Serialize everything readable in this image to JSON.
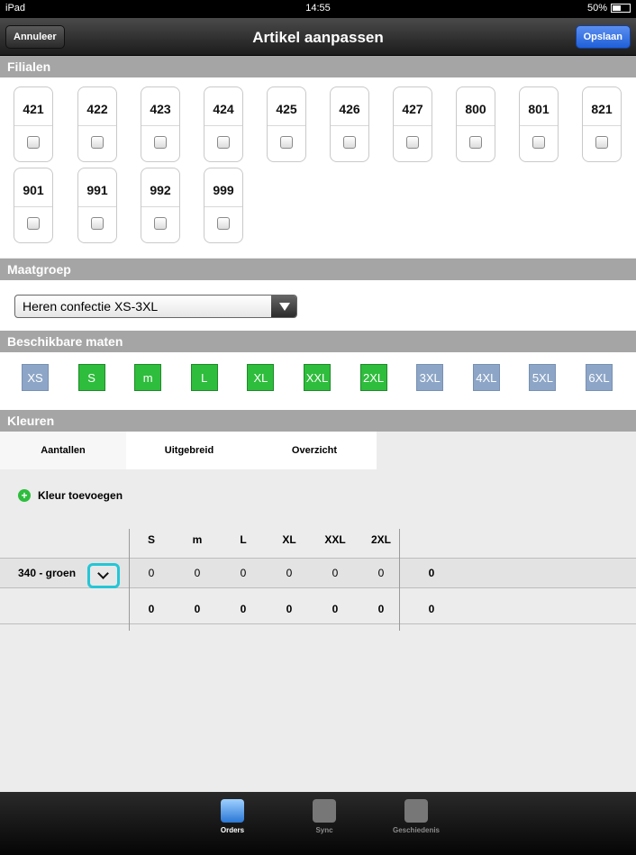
{
  "status_bar": {
    "device": "iPad",
    "time": "14:55",
    "battery": "50%"
  },
  "nav": {
    "title": "Artikel aanpassen",
    "cancel_label": "Annuleer",
    "save_label": "Opslaan"
  },
  "sections": {
    "filialen": "Filialen",
    "maatgroep": "Maatgroep",
    "maten": "Beschikbare maten",
    "kleuren": "Kleuren"
  },
  "filialen": [
    "421",
    "422",
    "423",
    "424",
    "425",
    "426",
    "427",
    "800",
    "801",
    "821",
    "901",
    "991",
    "992",
    "999"
  ],
  "maatgroep": {
    "selected": "Heren confectie XS-3XL"
  },
  "sizes": [
    {
      "label": "XS",
      "active": false
    },
    {
      "label": "S",
      "active": true
    },
    {
      "label": "m",
      "active": true
    },
    {
      "label": "L",
      "active": true
    },
    {
      "label": "XL",
      "active": true
    },
    {
      "label": "XXL",
      "active": true
    },
    {
      "label": "2XL",
      "active": true
    },
    {
      "label": "3XL",
      "active": false
    },
    {
      "label": "4XL",
      "active": false
    },
    {
      "label": "5XL",
      "active": false
    },
    {
      "label": "6XL",
      "active": false
    }
  ],
  "tabs": [
    "Aantallen",
    "Uitgebreid",
    "Overzicht"
  ],
  "add_color_label": "Kleur toevoegen",
  "grid": {
    "headers": [
      "S",
      "m",
      "L",
      "XL",
      "XXL",
      "2XL"
    ],
    "rows": [
      {
        "label": "340 - groen",
        "values": [
          "0",
          "0",
          "0",
          "0",
          "0",
          "0"
        ],
        "total": "0"
      }
    ],
    "totals": {
      "values": [
        "0",
        "0",
        "0",
        "0",
        "0",
        "0"
      ],
      "total": "0"
    }
  },
  "tabbar": [
    "Orders",
    "Sync",
    "Geschiedenis"
  ]
}
